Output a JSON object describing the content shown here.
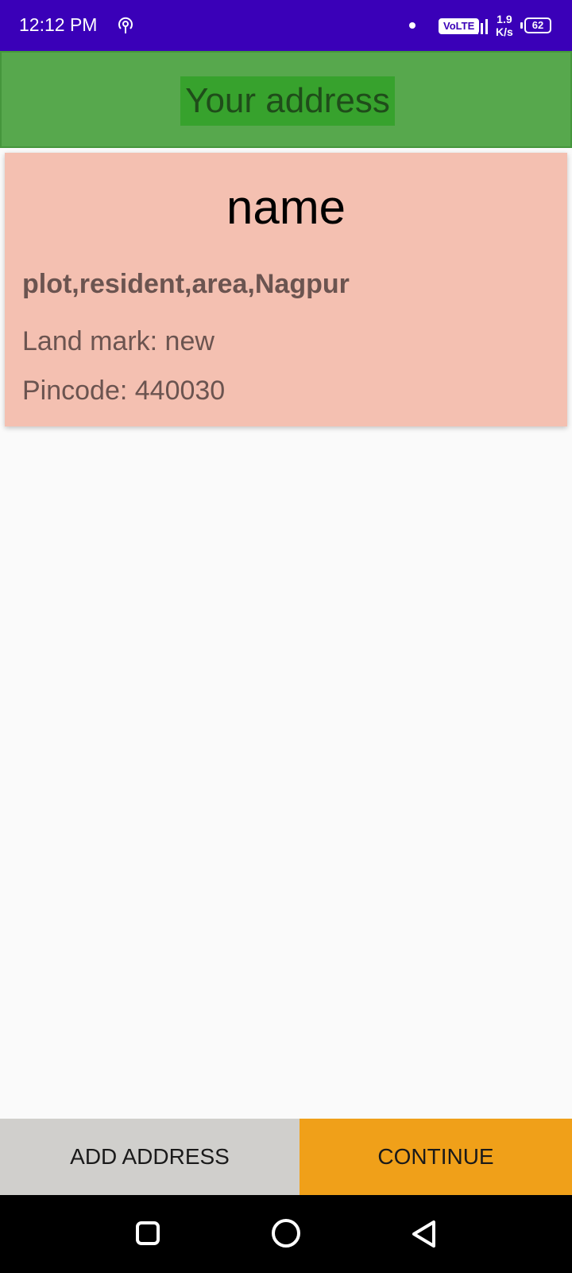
{
  "status_bar": {
    "time": "12:12 PM",
    "volte": "VoLTE",
    "net_speed_value": "1.9",
    "net_speed_unit": "K/s",
    "battery": "62",
    "icons": [
      "hotspot-icon",
      "notification-dot-icon",
      "signal-icon",
      "battery-icon"
    ]
  },
  "header": {
    "title": "Your address"
  },
  "address": {
    "name": "name",
    "street": "plot,resident,area,Nagpur",
    "landmark": "Land mark: new",
    "pincode": "Pincode: 440030"
  },
  "actions": {
    "add_address_label": "ADD ADDRESS",
    "continue_label": "CONTINUE"
  },
  "nav": {
    "icons": [
      "recents-icon",
      "home-icon",
      "back-icon"
    ]
  },
  "colors": {
    "status_bar": "#3a00b8",
    "header": "#57a84d",
    "card": "#f4c0b1",
    "add_button": "#d0cfcc",
    "continue_button": "#f0a019"
  }
}
